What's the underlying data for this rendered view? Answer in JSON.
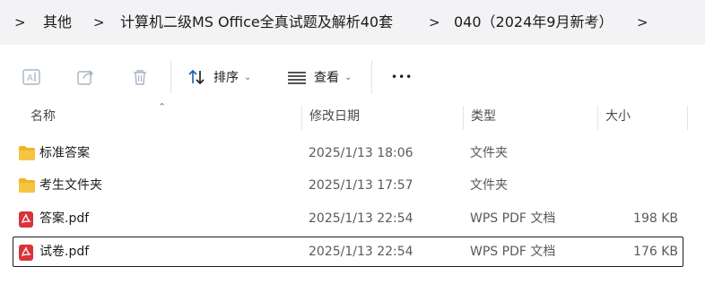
{
  "breadcrumb": {
    "items": [
      "其他",
      "计算机二级MS Office全真试题及解析40套",
      "040（2024年9月新考）"
    ],
    "separator": ">"
  },
  "toolbar": {
    "sort_label": "排序",
    "view_label": "查看",
    "more_label": "•••"
  },
  "columns": {
    "name": "名称",
    "modified": "修改日期",
    "type": "类型",
    "size": "大小"
  },
  "files": [
    {
      "name": "标准答案",
      "modified": "2025/1/13 18:06",
      "type": "文件夹",
      "size": "",
      "icon": "folder-icon"
    },
    {
      "name": "考生文件夹",
      "modified": "2025/1/13 17:57",
      "type": "文件夹",
      "size": "",
      "icon": "folder-icon"
    },
    {
      "name": "答案.pdf",
      "modified": "2025/1/13 22:54",
      "type": "WPS PDF 文档",
      "size": "198 KB",
      "icon": "pdf-icon"
    },
    {
      "name": "试卷.pdf",
      "modified": "2025/1/13 22:54",
      "type": "WPS PDF 文档",
      "size": "176 KB",
      "icon": "pdf-icon",
      "selected": true
    }
  ],
  "colors": {
    "folder": "#f6c443",
    "pdf": "#d9343b",
    "toolbar_disabled": "#a8b4c4"
  }
}
